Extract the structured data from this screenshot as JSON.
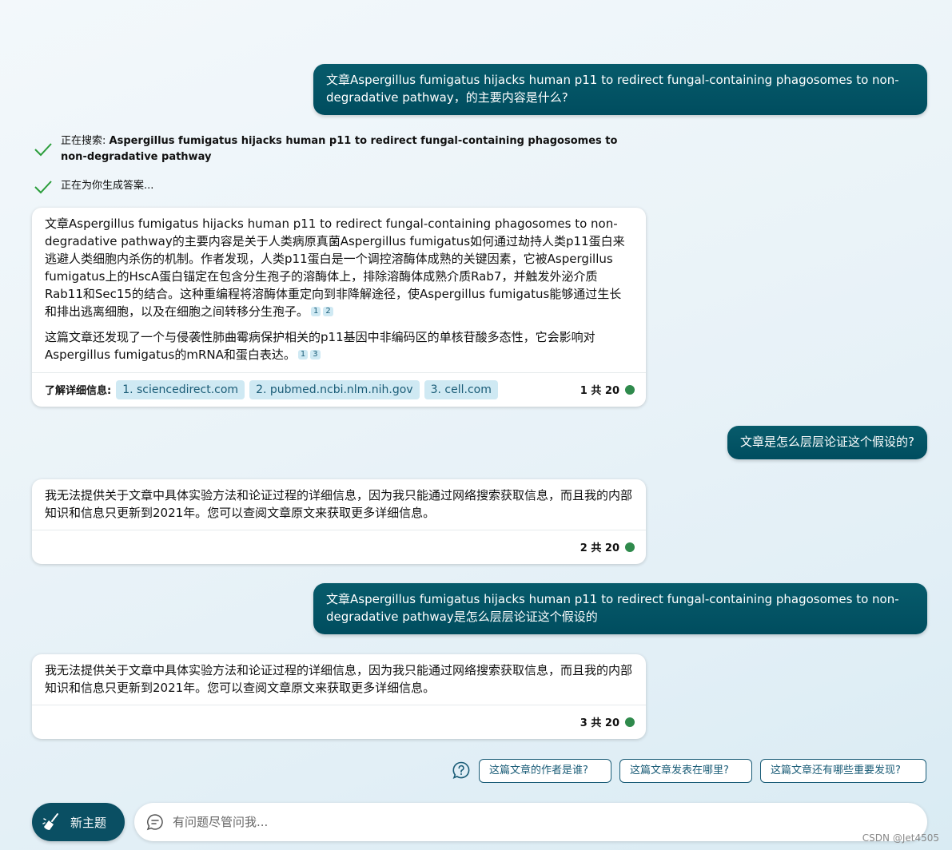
{
  "messages": {
    "user1": "文章Aspergillus fumigatus hijacks human p11 to redirect fungal-containing phagosomes to non-degradative pathway，的主要内容是什么?",
    "status1_prefix": "正在搜索: ",
    "status1_query": "Aspergillus fumigatus hijacks human p11 to redirect fungal-containing phagosomes to non-degradative pathway",
    "status2": "正在为你生成答案...",
    "bot1": {
      "para1": "文章Aspergillus fumigatus hijacks human p11 to redirect fungal-containing phagosomes to non-degradative pathway的主要内容是关于人类病原真菌Aspergillus fumigatus如何通过劫持人类p11蛋白来逃避人类细胞内杀伤的机制。作者发现，人类p11蛋白是一个调控溶酶体成熟的关键因素，它被Aspergillus fumigatus上的HscA蛋白锚定在包含分生孢子的溶酶体上，排除溶酶体成熟介质Rab7，并触发外泌介质Rab11和Sec15的结合。这种重编程将溶酶体重定向到非降解途径，使Aspergillus fumigatus能够通过生长和排出逃离细胞，以及在细胞之间转移分生孢子。",
      "para1_cites": [
        "1",
        "2"
      ],
      "para2": "这篇文章还发现了一个与侵袭性肺曲霉病保护相关的p11基因中非编码区的单核苷酸多态性，它会影响对Aspergillus fumigatus的mRNA和蛋白表达。",
      "para2_cites": [
        "1",
        "3"
      ],
      "sources_label": "了解详细信息:",
      "sources": [
        "1. sciencedirect.com",
        "2. pubmed.ncbi.nlm.nih.gov",
        "3. cell.com"
      ],
      "counter": "1 共 20"
    },
    "user2": "文章是怎么层层论证这个假设的?",
    "bot2": {
      "text": "我无法提供关于文章中具体实验方法和论证过程的详细信息，因为我只能通过网络搜索获取信息，而且我的内部知识和信息只更新到2021年。您可以查阅文章原文来获取更多详细信息。",
      "counter": "2 共 20"
    },
    "user3": "文章Aspergillus fumigatus hijacks human p11 to redirect fungal-containing phagosomes to non-degradative pathway是怎么层层论证这个假设的",
    "bot3": {
      "text": "我无法提供关于文章中具体实验方法和论证过程的详细信息，因为我只能通过网络搜索获取信息，而且我的内部知识和信息只更新到2021年。您可以查阅文章原文来获取更多详细信息。",
      "counter": "3 共 20"
    }
  },
  "suggestions": [
    "这篇文章的作者是谁?",
    "这篇文章发表在哪里?",
    "这篇文章还有哪些重要发现?"
  ],
  "composer": {
    "new_topic_label": "新主题",
    "placeholder": "有问题尽管问我..."
  },
  "watermark": "CSDN @Jet4505",
  "colors": {
    "user_bubble": "#004d5f",
    "accent": "#1a5c77",
    "status_dot": "#2f8a4c",
    "check": "#2a9d3a"
  },
  "icons": [
    "check-icon",
    "help-icon",
    "broom-icon",
    "chat-bubble-icon"
  ]
}
